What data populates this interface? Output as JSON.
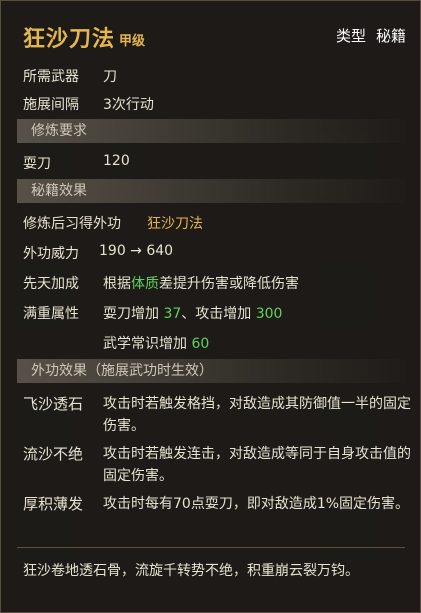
{
  "header": {
    "title": "狂沙刀法",
    "grade": "甲级",
    "type_label": "类型",
    "type_value": "秘籍"
  },
  "basic": [
    {
      "key": "所需武器",
      "value": "刀"
    },
    {
      "key": "施展间隔",
      "value": "3次行动"
    }
  ],
  "requirement": {
    "section_title": "修炼要求",
    "key": "耍刀",
    "value": "120"
  },
  "effects": {
    "section_title": "秘籍效果",
    "learn_key": "修炼后习得外功",
    "learn_value": "狂沙刀法",
    "power_key": "外功威力",
    "power_value": "190 → 640",
    "innate_key": "先天加成",
    "innate_prefix": "根据",
    "innate_attr": "体质",
    "innate_suffix": "差提升伤害或降低伤害",
    "full_key": "满重属性",
    "full_line1_a": "耍刀增加 ",
    "full_line1_b": "37",
    "full_line1_c": "、攻击增加 ",
    "full_line1_d": "300",
    "full_line2_a": "武学常识增加 ",
    "full_line2_b": "60"
  },
  "outer": {
    "section_title": "外功效果（施展武功时生效）",
    "items": [
      {
        "key": "飞沙透石",
        "value": "攻击时若触发格挡，对敌造成其防御值一半的固定伤害。"
      },
      {
        "key": "流沙不绝",
        "value": "攻击时若触发连击，对敌造成等同于自身攻击值的固定伤害。"
      },
      {
        "key": "厚积薄发",
        "value": "攻击时每有70点耍刀，即对敌造成1%固定伤害。"
      }
    ]
  },
  "flavor": "狂沙卷地透石骨，流旋千转势不绝，积重崩云裂万钧。",
  "colors": {
    "gold": "#e5b64d",
    "green": "#5fd35a",
    "cyan": "#58d6c4"
  }
}
